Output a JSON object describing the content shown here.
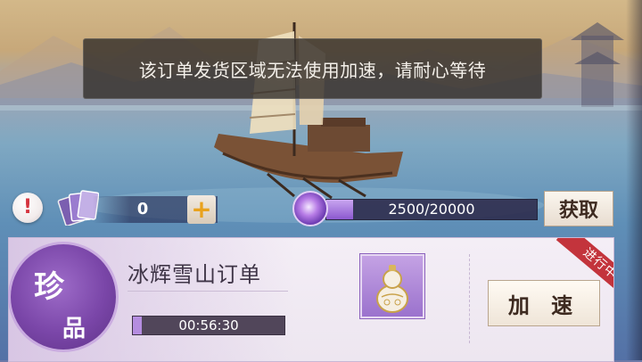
{
  "toast": {
    "message": "该订单发货区域无法使用加速，请耐心等待"
  },
  "resources": {
    "alert_mark": "!",
    "ticket_count": "0",
    "plus_label": "+",
    "currency_progress": {
      "text": "2500/20000",
      "current": 2500,
      "max": 20000
    },
    "get_button_label": "获取"
  },
  "order": {
    "rarity_char1": "珍",
    "rarity_char2": "品",
    "title": "冰辉雪山订单",
    "timer": {
      "text": "00:56:30",
      "fill_fraction": 0.06
    },
    "item_icon": "gourd-vase-icon",
    "speed_button_label": "加 速",
    "status_tag": "进行中"
  },
  "colors": {
    "accent_purple": "#8b58cf",
    "status_red": "#c3343c",
    "button_text": "#3d2a20"
  }
}
